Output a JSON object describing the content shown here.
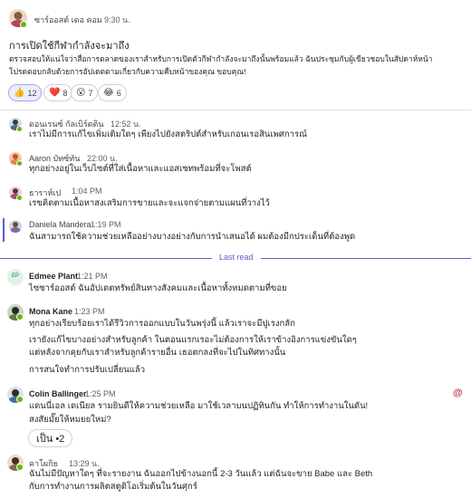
{
  "post": {
    "author": "ซาร์ออสต์ เดอ คอม",
    "time": "9:30 น.",
    "title": "การเปิดใช้กีฬากำลังจะมาถึง",
    "body_line1": "ตรวจสอบให้แน่ใจว่าสื่อการตลาดของเราสำหรับการเปิดตัวกีฬากำลังจะมาถึงนั้นพร้อมแล้ว  ฉันประชุมกับผู้เขียวชอบในสัปดาห์หน้า",
    "body_line2": "โปรดตอบกลับด้วยการอัปเดตตามเกี่ยวกับความคืบหน้าของคุณ ขอบคุณ!",
    "reactions": [
      {
        "emoji": "👍",
        "count": "12"
      },
      {
        "emoji": "❤️",
        "count": "8"
      },
      {
        "emoji": "😮",
        "count": "7"
      },
      {
        "emoji": "😂",
        "count": "6"
      }
    ]
  },
  "replies": [
    {
      "author": "ดอนเรนซ์ กัลเบิร์ตติน",
      "time": "12:52 น.",
      "text": "เราไม่มีการแก้ไขเพิ่มเติมใดๆ เพียงไปยังสตริปต์สำหรับเกอนเรอสินเพศการณ์"
    },
    {
      "author": "Aaron บัทซ์ทัน",
      "time": "22:00 น.",
      "text": "ทุกอย่างอยู่ในเว็บไซต์ที่ใส่เนื้อหาและแอสเซทพร้อมที่จะโพสต์"
    },
    {
      "author": "ธาราห์เป",
      "time": "1:04 PM",
      "text": "เรขคิดตามเนื้อหาสงเสริมการขายและจะแจกจ่ายตามแผนที่วางไว้"
    },
    {
      "author": "Daniela Mandera",
      "time": "1:19 PM",
      "text": "ฉันสามารถใช้ความช่วยเหลืออย่างบางอย่างกับการนำเสนอได้ ผมต้องมีกประเด็นที่ต้องพูด"
    }
  ],
  "last_read_label": "Last read",
  "unread": [
    {
      "author": "Edmee Plant",
      "time": "1:21 PM",
      "initials": "EP",
      "lines": [
        "ไซซาร์ออสต์ ฉันอัปเดตทรัพย์สินทางสังคมและเนื้อหาทั้งหมดตามที่ขอย"
      ]
    },
    {
      "author": "Mona Kane",
      "time": "1:23 PM",
      "lines": [
        "ทุกอย่างเรียบร้อยเราได้รีวิวการออกแบบในวันพรุ่งนี้ แล้วเราจะมีปูเรงกลัก",
        "เรายังแก้ไขบางอย่างสำหรับลูกค้า ในตอนแรกเรอะไม่ต้องการให้เราข้างอิงการแข่งขันใดๆ",
        "แต่หลังจากคุยกับเราสำหรับลูกค้ารายอื่น เธอตกลงที่จะไปในทิศทางนั้น",
        "การสนใจทำการปรับเปลี่ยนแล้ว"
      ]
    },
    {
      "author": "Colin Ballinger",
      "time": "1:25 PM",
      "mention": "@",
      "lines": [
        "แดนนี่เอล เดเนียล รามยินดีให้ความช่วยเหลือ มาใช้เวลาบนปฏิทินกัน ทำให้การทำงานในดัน!",
        "สงสัยมั๊ยให้หมยยใหม่?"
      ],
      "chip": "เป็น •2"
    },
    {
      "author": "คาโผกิย",
      "time": "13:29 น.",
      "lines": [
        "ฉันไม่มีปัญหาใดๆ ที่จะรายงาน  ฉันออกไปข้างนอกนี้ 2-3 วันแล้ว แต่ฉันจะขาย Babe และ Beth",
        "กับการทำงานการผลิตสตูดิโอเริ่มต้นในวันศุกร์"
      ]
    }
  ]
}
